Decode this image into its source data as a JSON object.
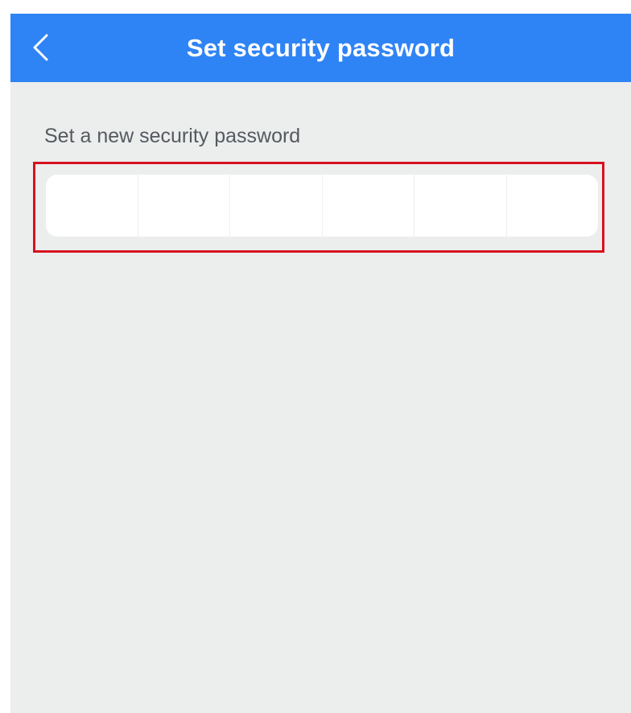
{
  "header": {
    "title": "Set security password",
    "back_icon": "chevron-left-icon",
    "background_color": "#2f84f5"
  },
  "form": {
    "label": "Set a new security password",
    "pin_length": 6,
    "pin_digits": [
      "",
      "",
      "",
      "",
      "",
      ""
    ]
  },
  "colors": {
    "screen_background": "#eceded",
    "highlight_border": "#d8111e",
    "field_background": "#ffffff"
  }
}
